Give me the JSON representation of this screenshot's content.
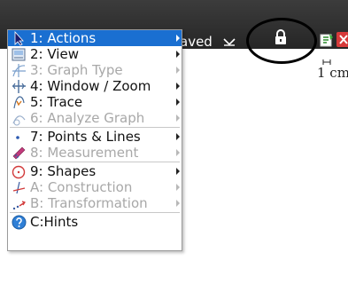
{
  "topbar": {
    "doc_status": "aved",
    "icons": [
      "chevron-down-icon",
      "lock-icon",
      "tool-icon",
      "close-icon"
    ]
  },
  "canvas": {
    "scale_label": "1 cm"
  },
  "menu": {
    "items": [
      {
        "label": "1: Actions",
        "enabled": true,
        "selected": true,
        "submenu": true,
        "icon": "arrow-pointer-icon"
      },
      {
        "label": "2: View",
        "enabled": true,
        "selected": false,
        "submenu": true,
        "icon": "view-icon"
      },
      {
        "label": "3: Graph Type",
        "enabled": false,
        "selected": false,
        "submenu": true,
        "icon": "graph-type-icon"
      },
      {
        "label": "4: Window / Zoom",
        "enabled": true,
        "selected": false,
        "submenu": true,
        "icon": "window-zoom-icon"
      },
      {
        "label": "5: Trace",
        "enabled": true,
        "selected": false,
        "submenu": true,
        "icon": "trace-icon"
      },
      {
        "label": "6: Analyze Graph",
        "enabled": false,
        "selected": false,
        "submenu": true,
        "icon": "analyze-graph-icon"
      },
      {
        "label": "7: Points & Lines",
        "enabled": true,
        "selected": false,
        "submenu": true,
        "icon": "points-lines-icon"
      },
      {
        "label": "8: Measurement",
        "enabled": false,
        "selected": false,
        "submenu": true,
        "icon": "measurement-icon"
      },
      {
        "label": "9: Shapes",
        "enabled": true,
        "selected": false,
        "submenu": true,
        "icon": "shapes-icon"
      },
      {
        "label": "A: Construction",
        "enabled": false,
        "selected": false,
        "submenu": true,
        "icon": "construction-icon"
      },
      {
        "label": "B: Transformation",
        "enabled": false,
        "selected": false,
        "submenu": true,
        "icon": "transformation-icon"
      },
      {
        "label": "C:Hints",
        "enabled": true,
        "selected": false,
        "submenu": false,
        "icon": "hints-icon"
      }
    ]
  },
  "colors": {
    "selection": "#1a6fd1",
    "disabled_text": "#a8a8a8",
    "topbar": "#2f2f2f",
    "lock_circle": "#000000"
  }
}
